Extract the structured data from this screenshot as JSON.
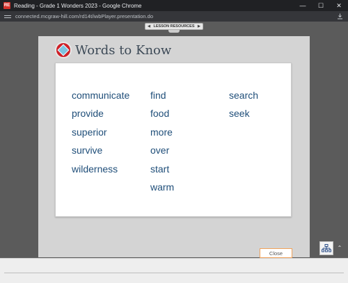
{
  "window": {
    "app_icon_text": "RE",
    "title": "Reading - Grade 1 Wonders 2023 - Google Chrome",
    "controls": {
      "minimize": "—",
      "maximize": "☐",
      "close": "✕"
    }
  },
  "address_bar": {
    "url": "connected.mcgraw-hill.com/rd14t/iwbPlayer.presentation.do",
    "icons": {
      "site_settings": "tune-icon",
      "download": "download-icon"
    }
  },
  "lesson_resources": {
    "prev": "◀",
    "label": "LESSON RESOURCES",
    "next": "▶"
  },
  "panel": {
    "title": "Words to Know",
    "columns": [
      [
        "communicate",
        "provide",
        "superior",
        "survive",
        "wilderness"
      ],
      [
        "find",
        "food",
        "more",
        "over",
        "start",
        "warm"
      ],
      [
        "search",
        "seek"
      ]
    ],
    "close_label": "Close"
  },
  "corner": {
    "sitemap_icon": "sitemap-icon",
    "caret": "⌃"
  },
  "colors": {
    "word": "#1f4e79",
    "title": "#3d4a57",
    "badge": "#cf2027",
    "close_border": "#f0a25a"
  }
}
